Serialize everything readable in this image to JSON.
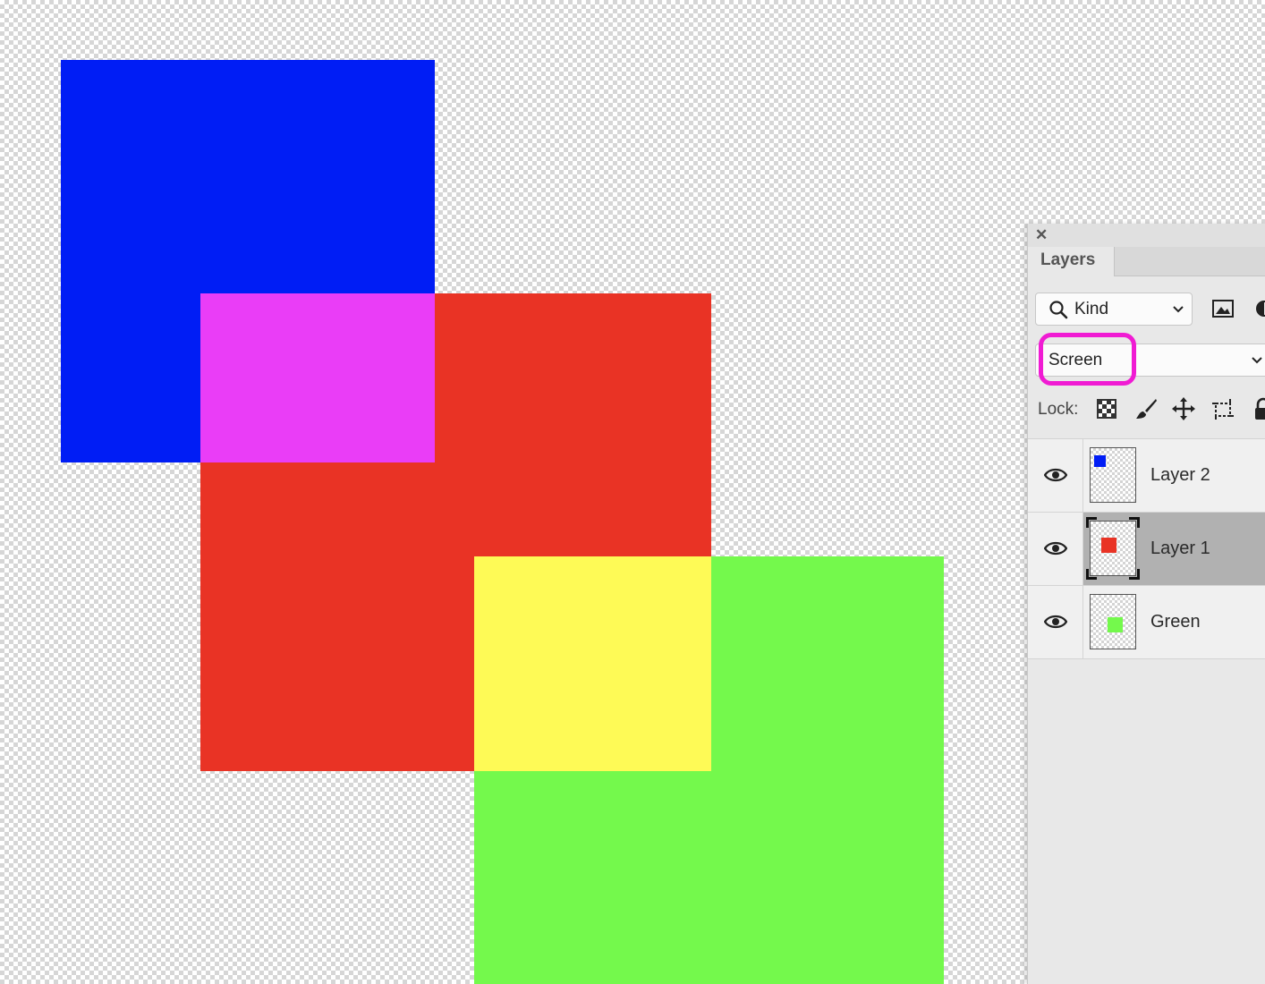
{
  "canvas": {
    "shapes": [
      {
        "name": "blue",
        "color": "#001DF5"
      },
      {
        "name": "red",
        "color": "#E93325"
      },
      {
        "name": "green",
        "color": "#74F94C"
      },
      {
        "name": "magenta-overlap",
        "color": "#EA3DF7"
      },
      {
        "name": "yellow-overlap",
        "color": "#FEFA56"
      }
    ]
  },
  "panel": {
    "tab_label": "Layers",
    "filter": {
      "kind_label": "Kind",
      "icons": [
        "search-icon",
        "chevron-down-icon",
        "image-filter-icon",
        "adjustment-filter-icon"
      ]
    },
    "blend_mode": "Screen",
    "highlight_color": "#F01BD3",
    "lock": {
      "label": "Lock:",
      "icons": [
        "lock-transparent-pixels-icon",
        "lock-image-pixels-icon",
        "lock-position-icon",
        "lock-artboard-icon",
        "lock-all-icon"
      ]
    },
    "layers": [
      {
        "name": "Layer 2",
        "visible": true,
        "selected": false,
        "thumb_color": "#001DF5"
      },
      {
        "name": "Layer 1",
        "visible": true,
        "selected": true,
        "thumb_color": "#E93325"
      },
      {
        "name": "Green",
        "visible": true,
        "selected": false,
        "thumb_color": "#74F94C"
      }
    ]
  }
}
